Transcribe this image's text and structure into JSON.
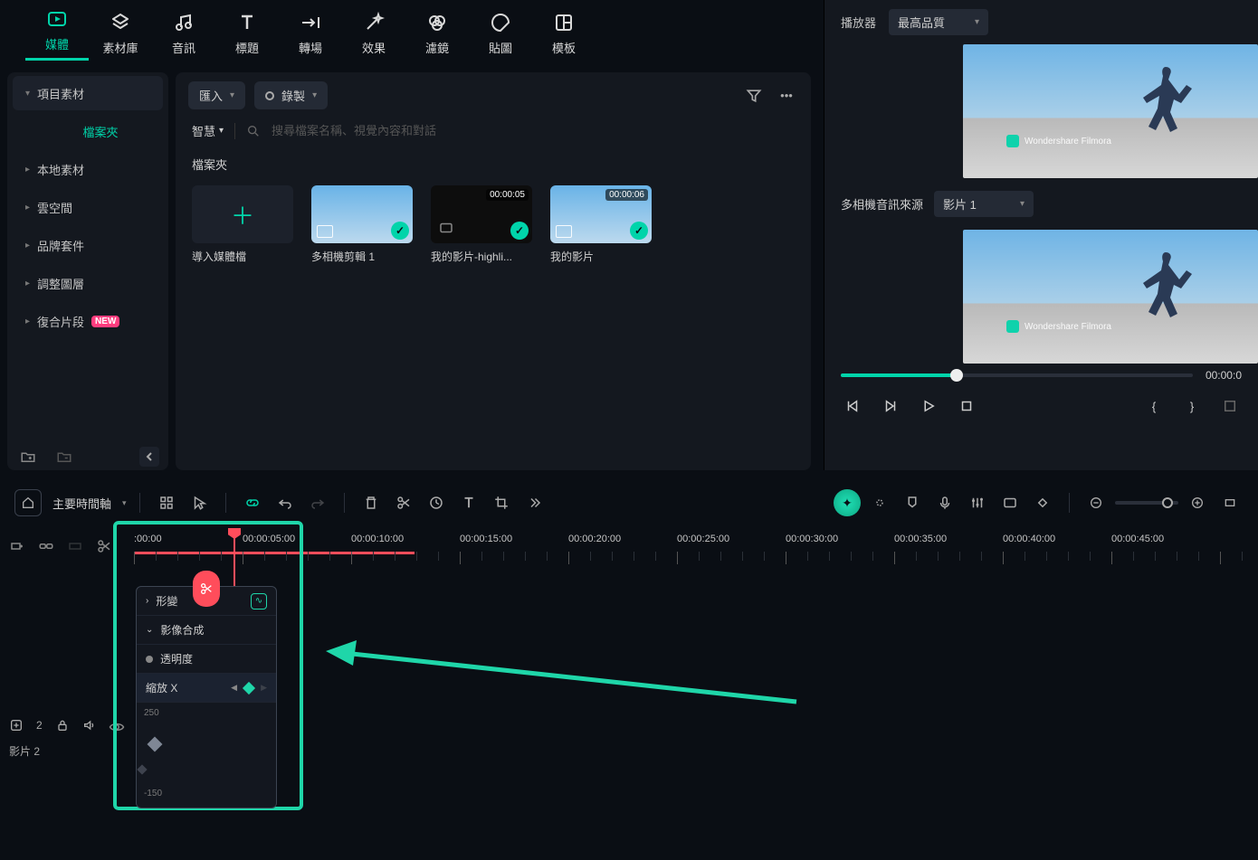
{
  "topNav": {
    "tabs": [
      {
        "id": "media",
        "label": "媒體"
      },
      {
        "id": "stock",
        "label": "素材庫"
      },
      {
        "id": "audio",
        "label": "音訊"
      },
      {
        "id": "title",
        "label": "標題"
      },
      {
        "id": "transition",
        "label": "轉場"
      },
      {
        "id": "effect",
        "label": "效果"
      },
      {
        "id": "filter",
        "label": "濾鏡"
      },
      {
        "id": "sticker",
        "label": "貼圖"
      },
      {
        "id": "template",
        "label": "模板"
      }
    ],
    "active": "media"
  },
  "sidebar": {
    "items": [
      {
        "id": "project",
        "label": "項目素材",
        "expanded": true
      },
      {
        "id": "folder",
        "label": "檔案夾",
        "active": true,
        "child": true
      },
      {
        "id": "local",
        "label": "本地素材"
      },
      {
        "id": "cloud",
        "label": "雲空間"
      },
      {
        "id": "brand",
        "label": "品牌套件"
      },
      {
        "id": "adjust",
        "label": "調整圖層"
      },
      {
        "id": "compound",
        "label": "復合片段",
        "badge": "NEW"
      }
    ]
  },
  "mediaPanel": {
    "importLabel": "匯入",
    "recordLabel": "錄製",
    "smartLabel": "智慧",
    "searchPlaceholder": "搜尋檔案名稱、視覺內容和對話",
    "sectionTitle": "檔案夾",
    "items": [
      {
        "id": "import",
        "label": "導入媒體檔",
        "type": "add"
      },
      {
        "id": "multicam",
        "label": "多相機剪輯 1",
        "type": "sky",
        "check": true
      },
      {
        "id": "highlight",
        "label": "我的影片-highli...",
        "type": "dark",
        "duration": "00:00:05",
        "check": true
      },
      {
        "id": "myvideo",
        "label": "我的影片",
        "type": "sky",
        "duration": "00:00:06",
        "check": true
      }
    ]
  },
  "player": {
    "title": "播放器",
    "qualityLabel": "最高品質",
    "audioSrcLabel": "多相機音訊來源",
    "audioSrcValue": "影片 1",
    "watermark": "Wondershare Filmora",
    "time": "00:00:0",
    "progressPct": 33
  },
  "timeline": {
    "mainLabel": "主要時間軸",
    "ruler": [
      ":00:00",
      "00:00:05:00",
      "00:00:10:00",
      "00:00:15:00",
      "00:00:20:00",
      "00:00:25:00",
      "00:00:30:00",
      "00:00:35:00",
      "00:00:40:00",
      "00:00:45:00"
    ],
    "trackCount": "2",
    "trackLabel": "影片 2"
  },
  "keyframePanel": {
    "rows": [
      {
        "id": "shape",
        "label": "形變",
        "chev": "›",
        "curve": true
      },
      {
        "id": "compose",
        "label": "影像合成",
        "chev": "⌄"
      },
      {
        "id": "opacity",
        "label": "透明度",
        "bullet": true
      },
      {
        "id": "scalex",
        "label": "縮放 X",
        "selected": true,
        "kf": true
      }
    ],
    "yTop": "250",
    "yBot": "-150"
  }
}
